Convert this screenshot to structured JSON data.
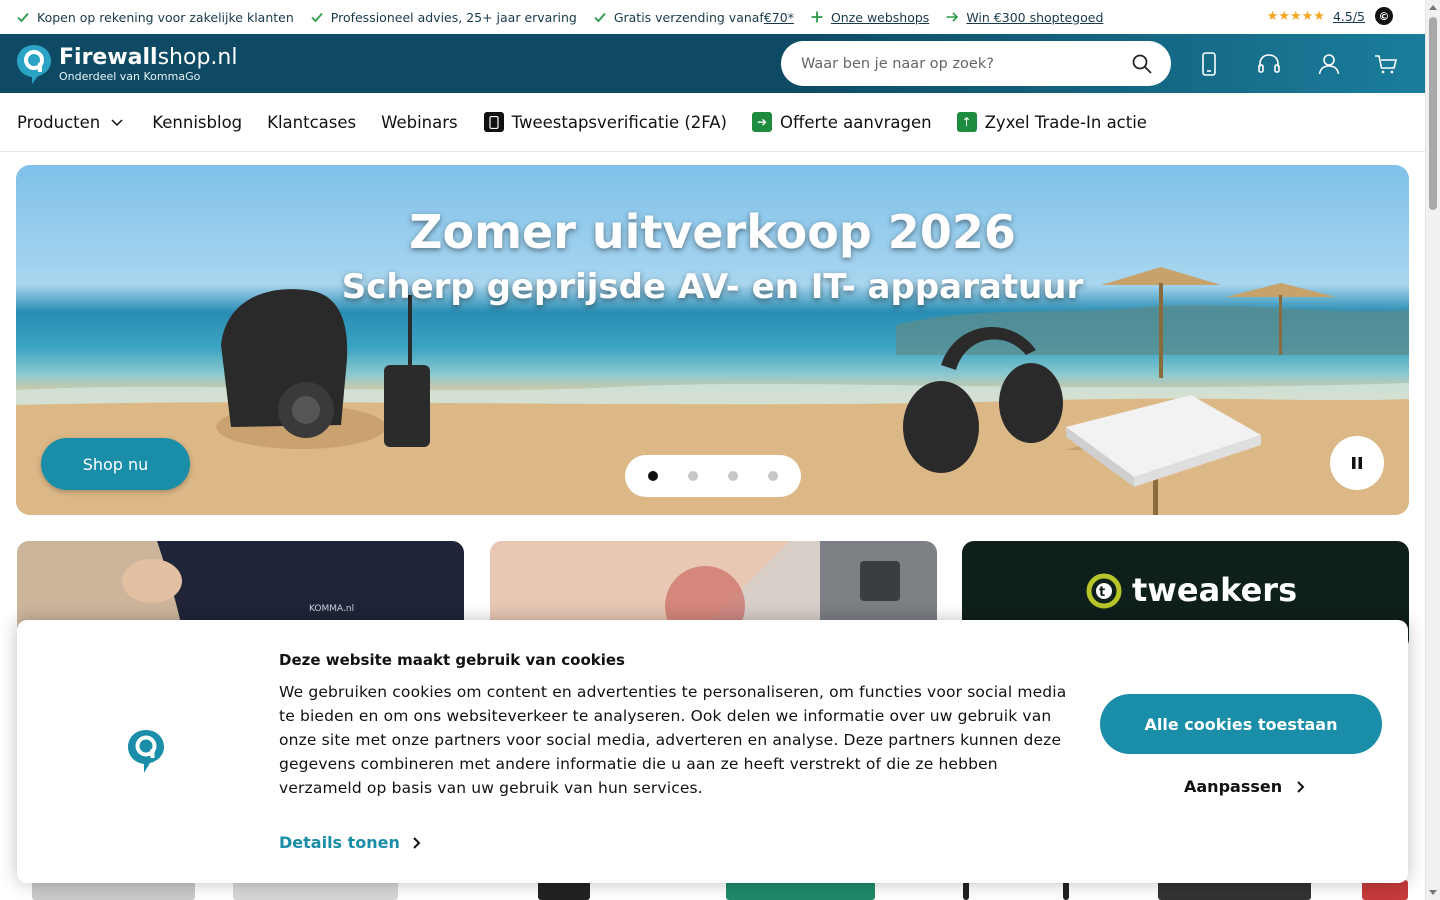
{
  "usp_bar": {
    "items": [
      {
        "label": "Kopen op rekening voor zakelijke klanten",
        "icon": "check-icon"
      },
      {
        "label": "Professioneel advies, 25+ jaar ervaring",
        "icon": "check-icon"
      },
      {
        "label": "Gratis verzending vanaf ",
        "link": "€70*",
        "icon": "check-icon"
      },
      {
        "label": "Onze webshops",
        "icon": "plus-icon"
      },
      {
        "label": "Win €300 shoptegoed",
        "icon": "arrow-right-icon"
      }
    ],
    "rating": "4.5/5",
    "stars": "★★★★★",
    "kiyoh_letter": "©"
  },
  "header": {
    "logo_bold": "Firewall",
    "logo_light": "shop.nl",
    "logo_sub": "Onderdeel van KommaGo",
    "search_placeholder": "Waar ben je naar op zoek?"
  },
  "nav": {
    "products": "Producten",
    "blog": "Kennisblog",
    "cases": "Klantcases",
    "webinars": "Webinars",
    "twofa": "Tweestapsverificatie (2FA)",
    "quote": "Offerte aanvragen",
    "tradein": "Zyxel Trade-In actie"
  },
  "hero": {
    "title": "Zomer uitverkoop 2026",
    "subtitle": "Scherp geprijsde AV- en IT- apparatuur",
    "cta": "Shop nu",
    "active_slide": 1,
    "slide_count": 4
  },
  "cards": {
    "tweakers_label": "tweakers"
  },
  "cookie": {
    "title": "Deze website maakt gebruik van cookies",
    "text": "We gebruiken cookies om content en advertenties te personaliseren, om functies voor social media te bieden en om ons websiteverkeer te analyseren. Ook delen we informatie over uw gebruik van onze site met onze partners voor social media, adverteren en analyse. Deze partners kunnen deze gegevens combineren met andere informatie die u aan ze heeft verstrekt of die ze hebben verzameld op basis van uw gebruik van hun services.",
    "details": "Details tonen",
    "accept": "Alle cookies toestaan",
    "customize": "Aanpassen"
  },
  "colors": {
    "brand_dark": "#0e4a63",
    "brand_teal": "#1a8ea9",
    "check_green": "#2e9b4a"
  }
}
